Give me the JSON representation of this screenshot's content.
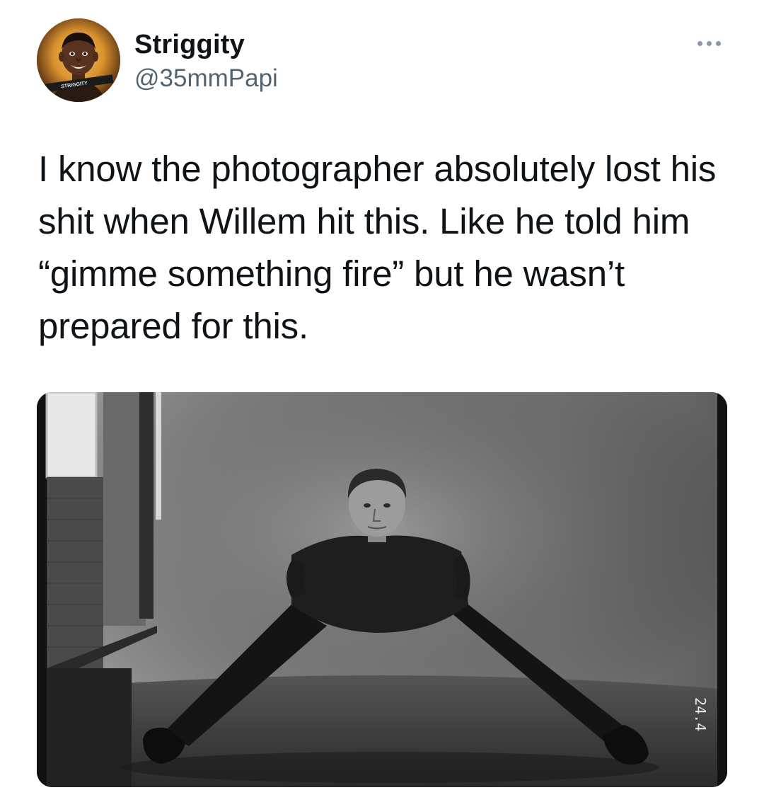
{
  "tweet": {
    "display_name": "Striggity",
    "handle": "@35mmPapi",
    "more_icon": "more-horizontal-icon",
    "text": "I know the photographer absolutely lost his shit when Willem hit this. Like he told him “gimme something fire” but he wasn’t prepared for this.",
    "media": {
      "film_marker": "24.4"
    },
    "avatar": {
      "badge_text": "STRIGGITY"
    }
  },
  "colors": {
    "text_primary": "#0f1419",
    "text_secondary": "#536471",
    "background": "#ffffff"
  }
}
